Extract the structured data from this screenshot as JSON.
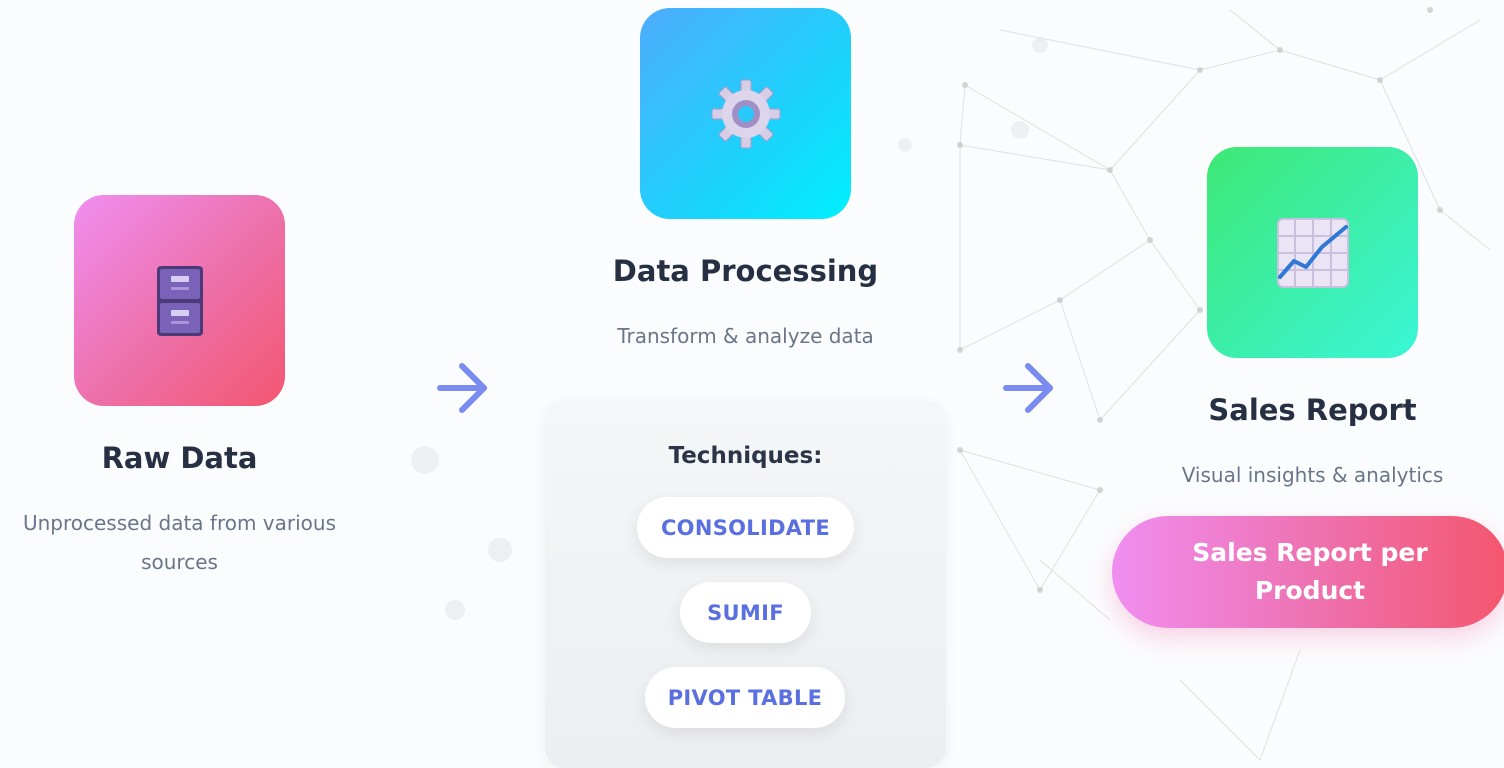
{
  "steps": {
    "raw": {
      "title": "Raw Data",
      "subtitle": "Unprocessed data from various sources",
      "icon": "file-cabinet-icon"
    },
    "processing": {
      "title": "Data Processing",
      "subtitle": "Transform & analyze data",
      "icon": "gear-icon",
      "techniques_label": "Techniques:",
      "techniques": [
        "CONSOLIDATE",
        "SUMIF",
        "PIVOT TABLE"
      ]
    },
    "report": {
      "title": "Sales Report",
      "subtitle": "Visual insights & analytics",
      "icon": "chart-increasing-icon",
      "button_label": "Sales Report per Product"
    }
  },
  "arrows": [
    "arrow-right-icon",
    "arrow-right-icon"
  ],
  "colors": {
    "arrow": "#7a8cf0",
    "title": "#273043",
    "subtitle": "#6b7589",
    "pill_text": "#5a6fe0",
    "raw_tile": [
      "#f08ef1",
      "#f45670"
    ],
    "processing_tile": [
      "#4facfe",
      "#00f0fe"
    ],
    "report_tile": [
      "#3ee874",
      "#3af6d6"
    ],
    "button": [
      "#f08ef1",
      "#f4566d"
    ]
  }
}
